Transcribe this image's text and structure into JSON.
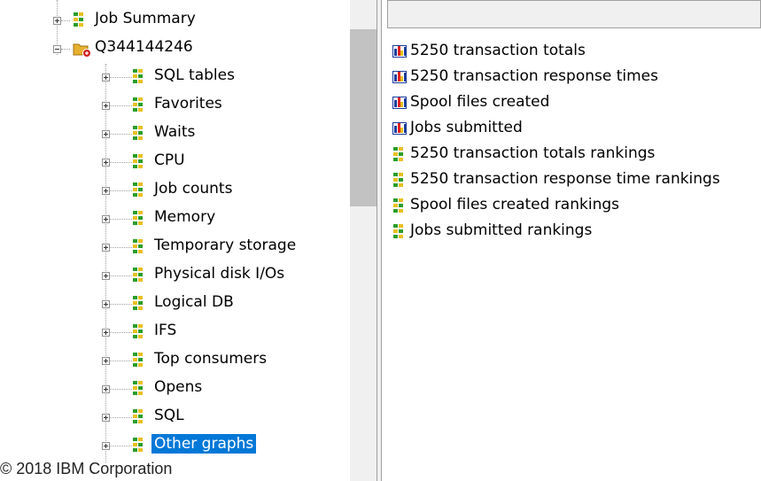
{
  "tree": {
    "top_item": "Job Summary",
    "root": "Q344144246",
    "children": [
      "SQL tables",
      "Favorites",
      "Waits",
      "CPU",
      "Job counts",
      "Memory",
      "Temporary storage",
      "Physical disk I/Os",
      "Logical DB",
      "IFS",
      "Top consumers",
      "Opens",
      "SQL",
      "Other graphs"
    ],
    "selected": "Other graphs"
  },
  "list": {
    "items": [
      {
        "label": "5250 transaction totals",
        "icon": "chart-icon"
      },
      {
        "label": "5250 transaction response times",
        "icon": "chart-icon"
      },
      {
        "label": "Spool files created",
        "icon": "chart-icon"
      },
      {
        "label": "Jobs submitted",
        "icon": "chart-icon"
      },
      {
        "label": "5250 transaction totals rankings",
        "icon": "grid-icon"
      },
      {
        "label": "5250 transaction response time rankings",
        "icon": "grid-icon"
      },
      {
        "label": "Spool files created rankings",
        "icon": "grid-icon"
      },
      {
        "label": "Jobs submitted rankings",
        "icon": "grid-icon"
      }
    ]
  },
  "footer": {
    "copyright": "© 2018 IBM Corporation"
  },
  "colors": {
    "selection": "#0078d7",
    "chart_border": "#1a3b9c",
    "folder": "#e8b030"
  }
}
